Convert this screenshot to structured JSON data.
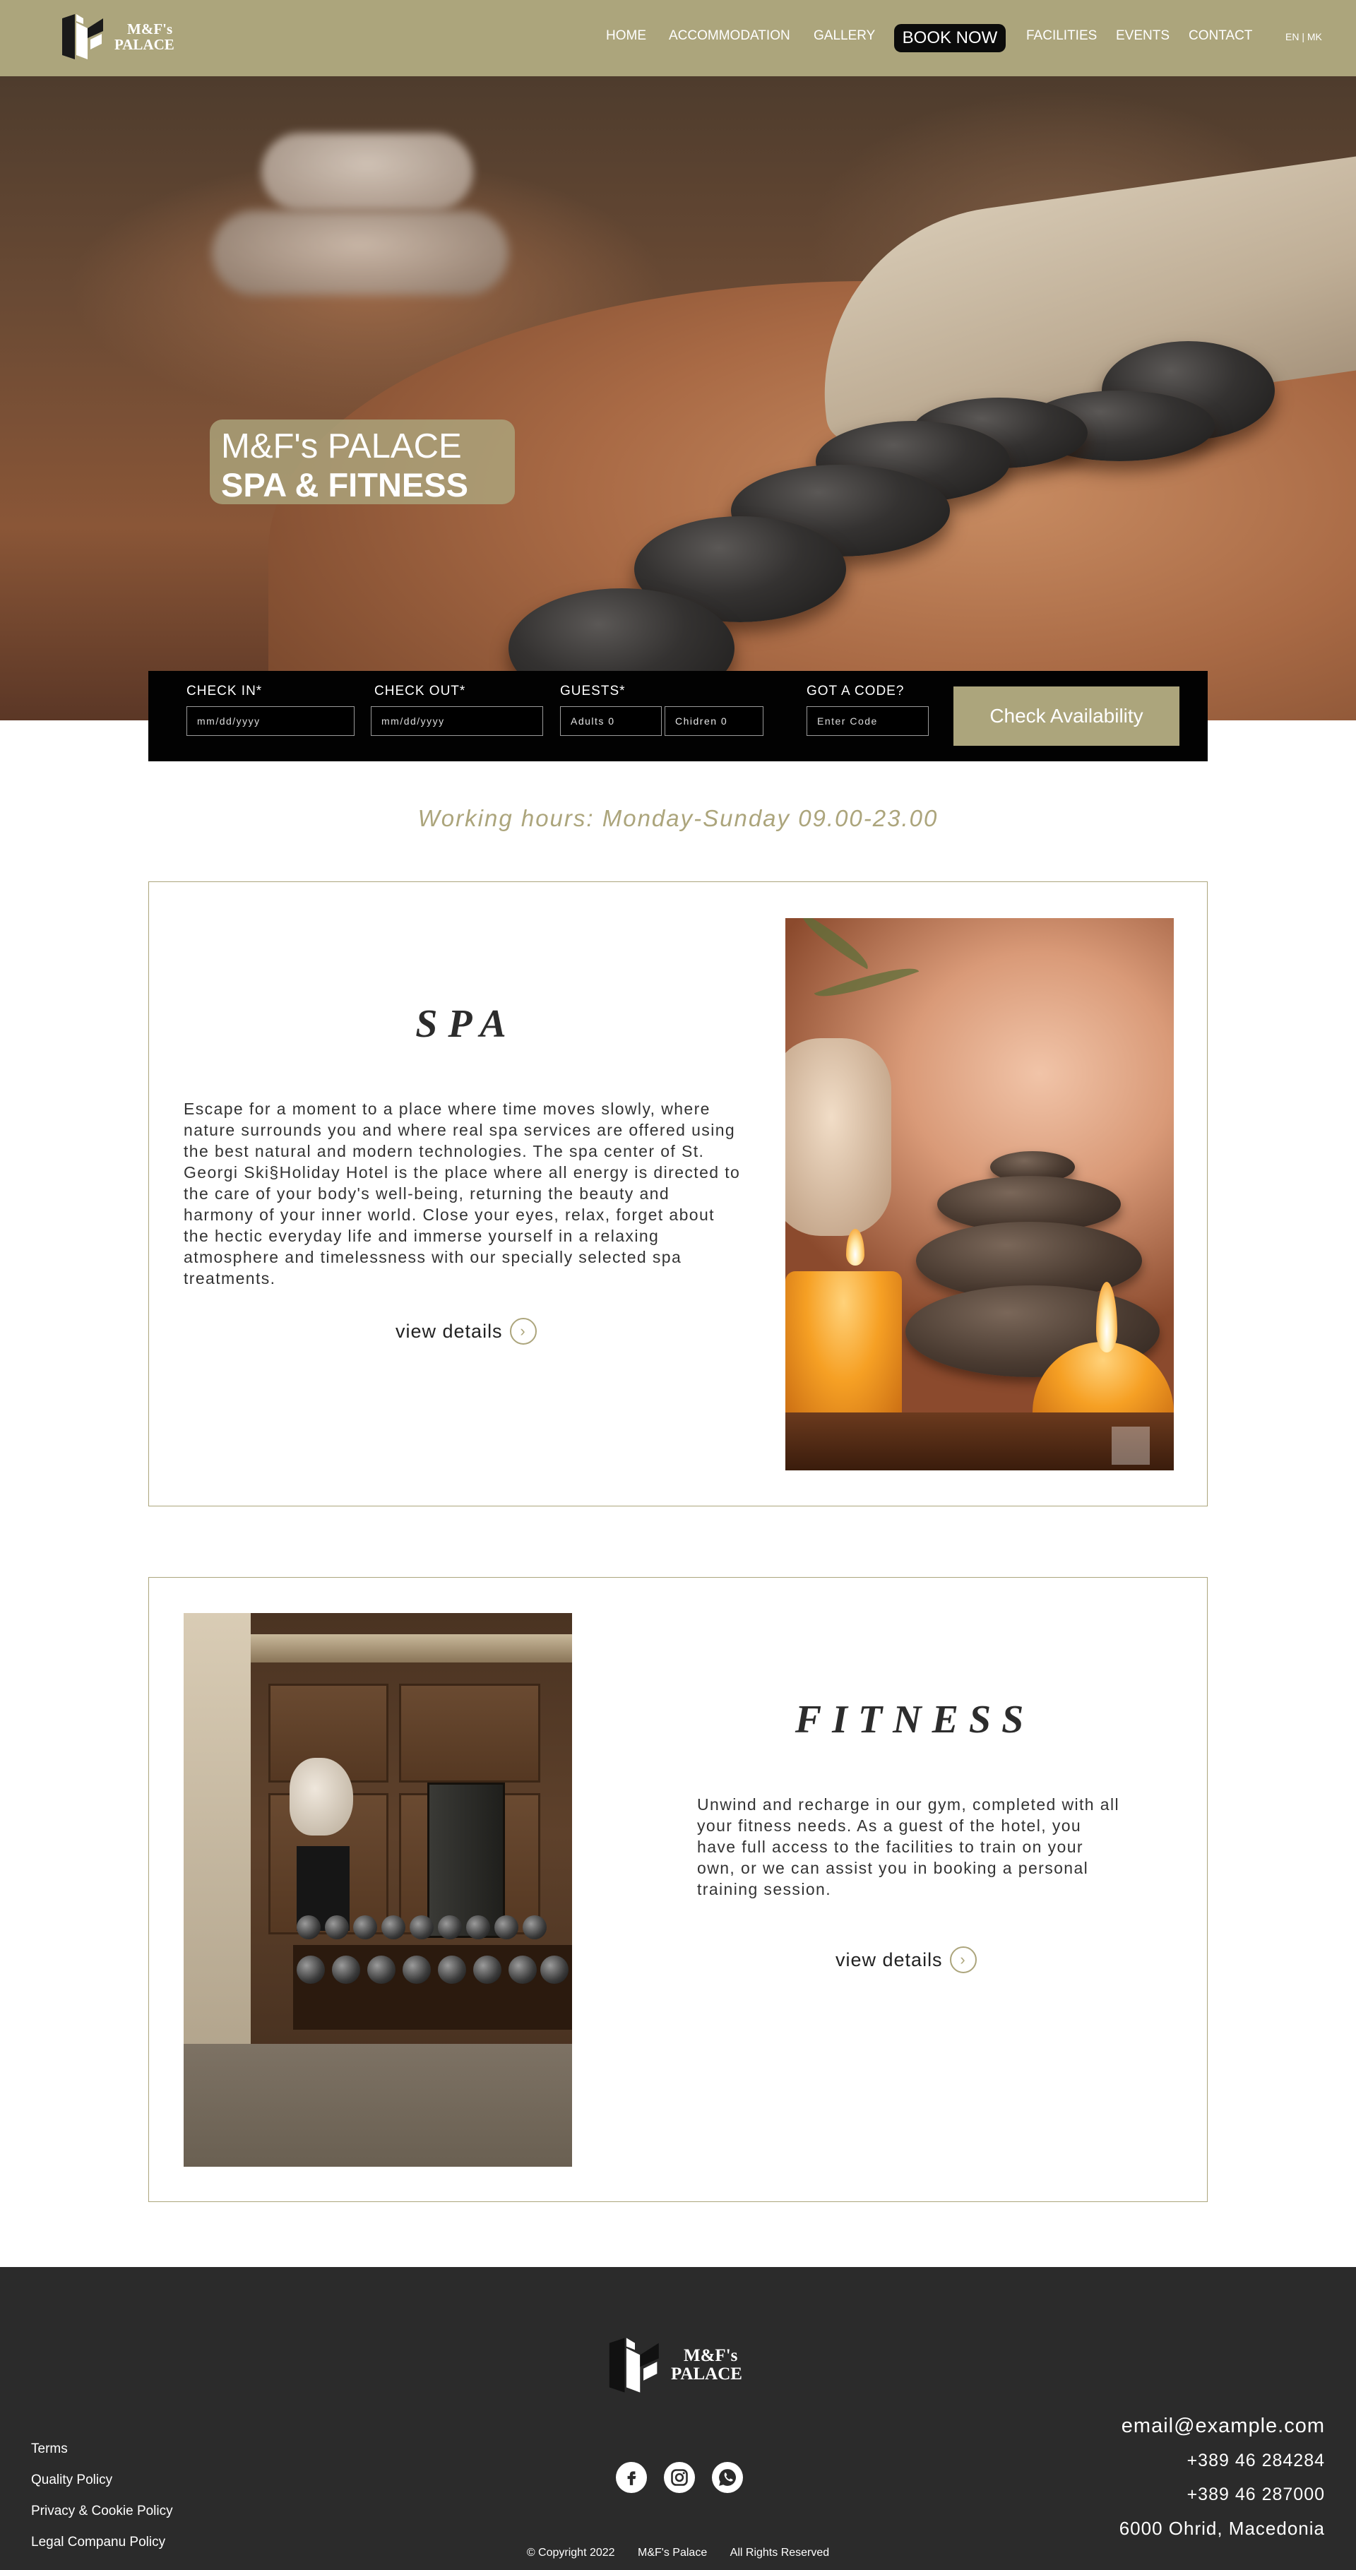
{
  "brand": {
    "name_line1": "M&F's",
    "name_line2": "PALACE",
    "accent_color": "#aca57c"
  },
  "nav": {
    "items": [
      "HOME",
      "ACCOMMODATION",
      "GALLERY",
      "BOOK NOW",
      "FACILITIES",
      "EVENTS",
      "CONTACT"
    ],
    "book_now": "BOOK NOW",
    "languages": "EN | MK"
  },
  "hero": {
    "line1": "M&F's PALACE",
    "line2": "SPA & FITNESS"
  },
  "booking": {
    "check_in_label": "CHECK IN*",
    "check_in_placeholder": "mm/dd/yyyy",
    "check_out_label": "CHECK OUT*",
    "check_out_placeholder": "mm/dd/yyyy",
    "guests_label": "GUESTS*",
    "adults_value": "Adults 0",
    "children_value": "Chidren 0",
    "code_label": "GOT A CODE?",
    "code_placeholder": "Enter Code",
    "submit_label": "Check Availability"
  },
  "working_hours": "Working hours: Monday-Sunday  09.00-23.00",
  "spa": {
    "title": "SPA",
    "text": "Escape for a moment to a place where time moves slowly, where nature surrounds you and where real spa services are offered using the best natural and modern technologies. The spa center of St. Georgi Ski§Holiday Hotel is the place where all energy is directed to the care of your body's well-being, returning the beauty and harmony of your inner world. Close your eyes, relax, forget about the hectic everyday life and immerse yourself in a relaxing atmosphere and timelessness with our specially selected spa treatments.",
    "link_label": "view details",
    "link_icon": "chevron-right-circle-icon"
  },
  "fitness": {
    "title": "FITNESS",
    "text": "Unwind and recharge in our gym, completed with all your fitness needs. As a guest of the hotel, you have full access to the facilities to train on your own, or we can assist you in booking a personal training session.",
    "link_label": "view details",
    "link_icon": "chevron-right-circle-icon"
  },
  "footer": {
    "links": [
      "Terms",
      "Quality Policy",
      "Privacy & Cookie Policy",
      "Legal Companu Policy"
    ],
    "social_icons": [
      "facebook-icon",
      "instagram-icon",
      "whatsapp-icon"
    ],
    "email": "email@example.com",
    "phone1": "+389 46 284284",
    "phone2": "+389 46 287000",
    "address": "6000 Ohrid, Macedonia",
    "copyright": "© Copyright 2022",
    "copyright_brand": "M&F's Palace",
    "rights": "All Rights Reserved",
    "background": "#2b2b2b"
  }
}
